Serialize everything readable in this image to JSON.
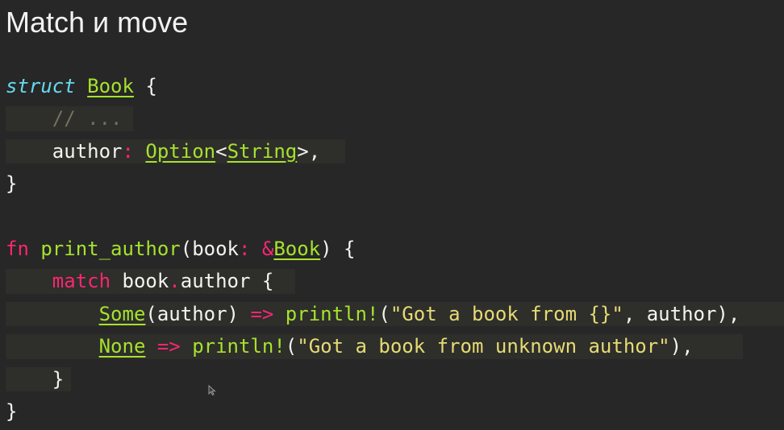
{
  "slide": {
    "title": "Match и move"
  },
  "code": {
    "lines": [
      {
        "indent": 0,
        "tokens": [
          {
            "t": "struct",
            "k": "kw-italic"
          },
          {
            "t": " ",
            "k": "plain"
          },
          {
            "t": "Book",
            "k": "type"
          },
          {
            "t": " {",
            "k": "plain"
          }
        ]
      },
      {
        "indent": 1,
        "tokens": [
          {
            "t": "    ",
            "k": "plain"
          },
          {
            "t": "// ...",
            "k": "comment"
          }
        ]
      },
      {
        "indent": 1,
        "tokens": [
          {
            "t": "    author",
            "k": "plain"
          },
          {
            "t": ":",
            "k": "kw"
          },
          {
            "t": " ",
            "k": "plain"
          },
          {
            "t": "Option",
            "k": "type"
          },
          {
            "t": "<",
            "k": "plain"
          },
          {
            "t": "String",
            "k": "type"
          },
          {
            "t": ">,",
            "k": "plain"
          }
        ]
      },
      {
        "indent": 0,
        "tokens": [
          {
            "t": "}",
            "k": "plain"
          }
        ]
      },
      {
        "indent": 0,
        "tokens": []
      },
      {
        "indent": 0,
        "tokens": [
          {
            "t": "fn",
            "k": "kw"
          },
          {
            "t": " ",
            "k": "plain"
          },
          {
            "t": "print_author",
            "k": "fn"
          },
          {
            "t": "(book",
            "k": "plain"
          },
          {
            "t": ":",
            "k": "kw"
          },
          {
            "t": " ",
            "k": "plain"
          },
          {
            "t": "&",
            "k": "kw"
          },
          {
            "t": "Book",
            "k": "type"
          },
          {
            "t": ") {",
            "k": "plain"
          }
        ]
      },
      {
        "indent": 1,
        "tokens": [
          {
            "t": "    ",
            "k": "plain"
          },
          {
            "t": "match",
            "k": "kw"
          },
          {
            "t": " book",
            "k": "plain"
          },
          {
            "t": ".",
            "k": "kw"
          },
          {
            "t": "author {",
            "k": "plain"
          }
        ]
      },
      {
        "indent": 2,
        "tokens": [
          {
            "t": "        ",
            "k": "plain"
          },
          {
            "t": "Some",
            "k": "type"
          },
          {
            "t": "(author) ",
            "k": "plain"
          },
          {
            "t": "=>",
            "k": "kw"
          },
          {
            "t": " ",
            "k": "plain"
          },
          {
            "t": "println!",
            "k": "fn"
          },
          {
            "t": "(",
            "k": "plain"
          },
          {
            "t": "\"Got a book from {}\"",
            "k": "str"
          },
          {
            "t": ", author),",
            "k": "plain"
          }
        ]
      },
      {
        "indent": 2,
        "tokens": [
          {
            "t": "        ",
            "k": "plain"
          },
          {
            "t": "None",
            "k": "type"
          },
          {
            "t": " ",
            "k": "plain"
          },
          {
            "t": "=>",
            "k": "kw"
          },
          {
            "t": " ",
            "k": "plain"
          },
          {
            "t": "println!",
            "k": "fn"
          },
          {
            "t": "(",
            "k": "plain"
          },
          {
            "t": "\"Got a book from unknown author\"",
            "k": "str"
          },
          {
            "t": "),",
            "k": "plain"
          }
        ]
      },
      {
        "indent": 1,
        "tokens": [
          {
            "t": "    }",
            "k": "plain"
          }
        ]
      },
      {
        "indent": 0,
        "tokens": [
          {
            "t": "}",
            "k": "plain"
          }
        ]
      }
    ]
  },
  "theme": {
    "background": "#272727",
    "keyword": "#f92672",
    "keyword_italic": "#66d9ef",
    "type": "#a6e22e",
    "string": "#e6db74",
    "comment": "#75715e",
    "text": "#f3f3f0"
  },
  "cursor": {
    "icon": "mouse-pointer-icon"
  }
}
